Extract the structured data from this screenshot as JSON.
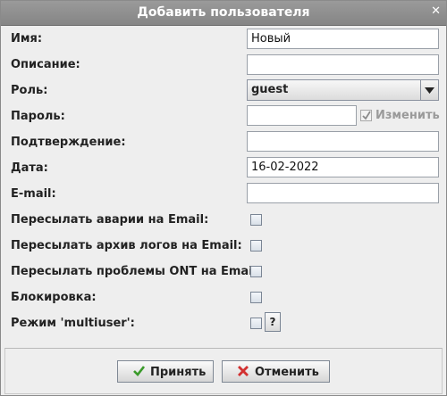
{
  "window": {
    "title": "Добавить пользователя",
    "close_glyph": "✕"
  },
  "form": {
    "name_label": "Имя:",
    "name_value": "Новый",
    "description_label": "Описание:",
    "description_value": "",
    "role_label": "Роль:",
    "role_value": "guest",
    "password_label": "Пароль:",
    "password_value": "",
    "change_label": "Изменить",
    "confirm_label": "Подтверждение:",
    "confirm_value": "",
    "date_label": "Дата:",
    "date_value": "16-02-2022",
    "email_label": "E-mail:",
    "email_value": "",
    "fwd_alarms_label": "Пересылать аварии на Email:",
    "fwd_logs_label": "Пересылать архив логов на Email:",
    "fwd_ont_label": "Пересылать проблемы ONT на Email:",
    "block_label": "Блокировка:",
    "multiuser_label": "Режим 'multiuser':",
    "help_label": "?"
  },
  "buttons": {
    "accept": "Принять",
    "cancel": "Отменить"
  },
  "colors": {
    "accept_icon": "#3a9a2a",
    "cancel_icon": "#d23030",
    "titlebar": "#8f8f8f"
  }
}
